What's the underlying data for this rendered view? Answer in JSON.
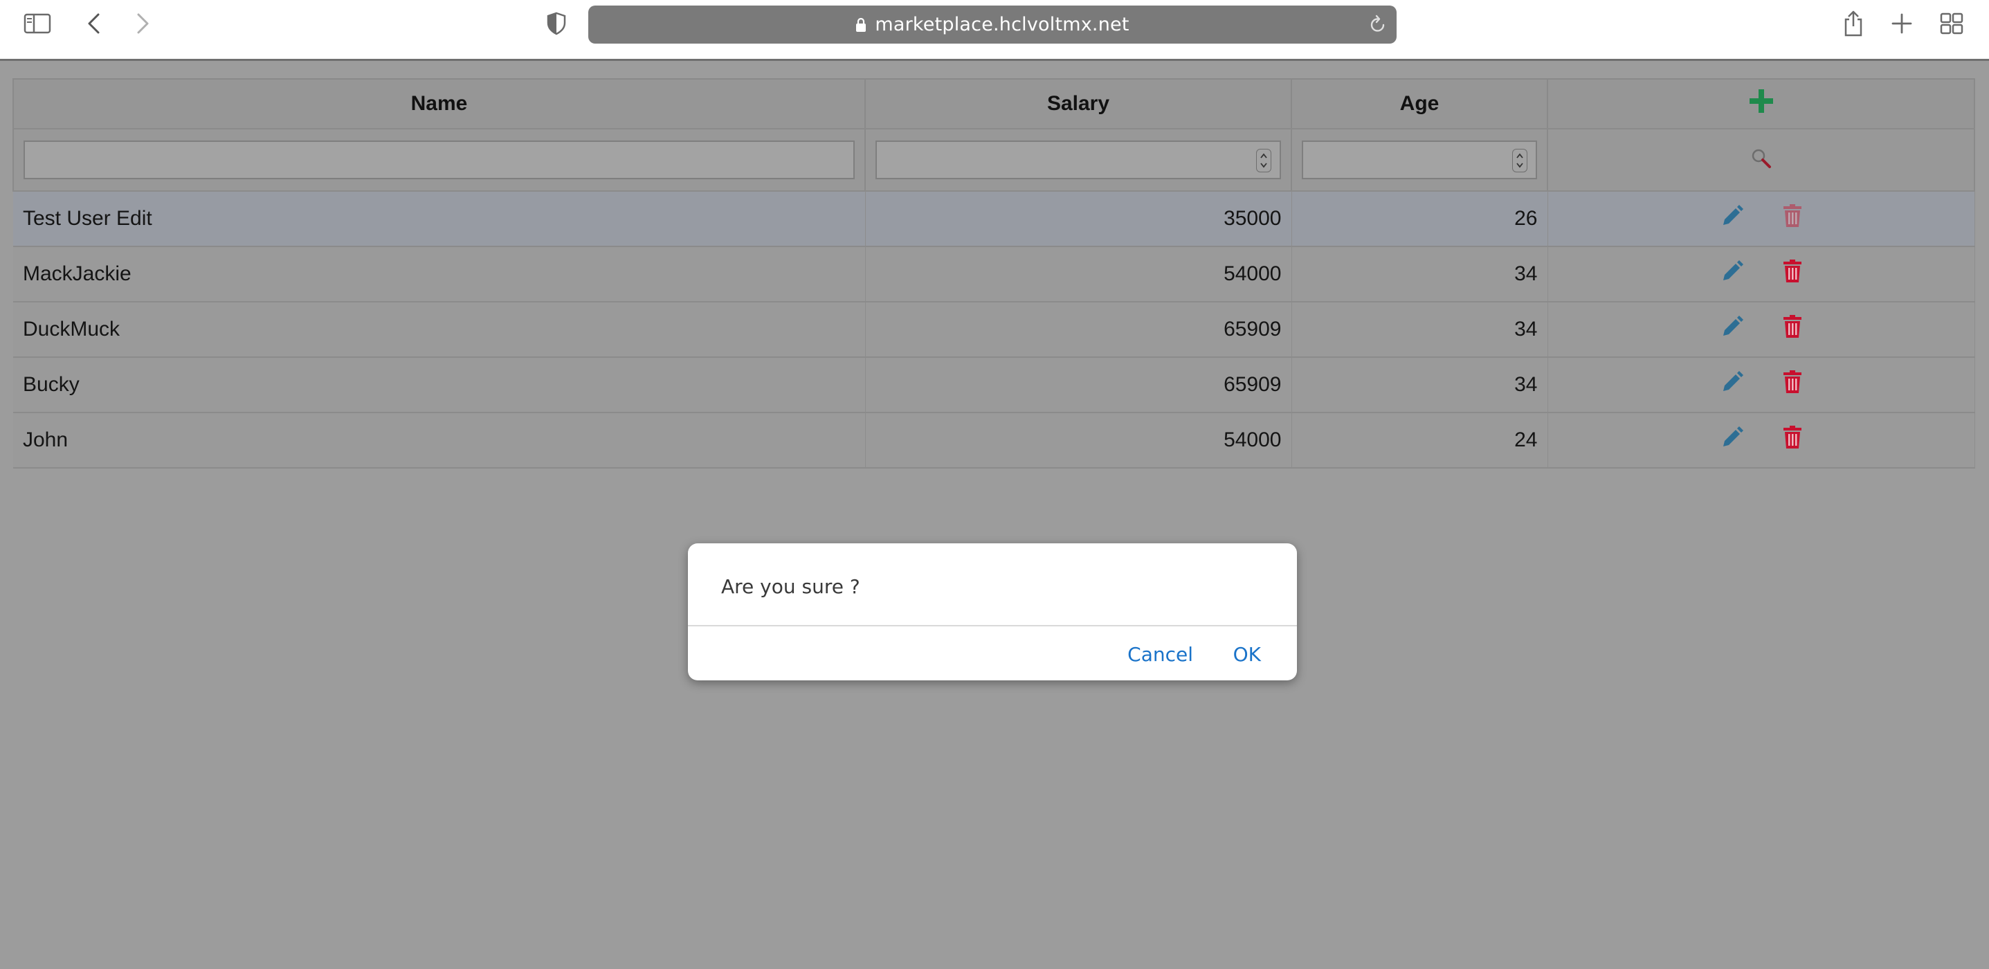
{
  "browser": {
    "url": "marketplace.hclvoltmx.net",
    "icons": [
      "sidebar-icon",
      "back-icon",
      "forward-icon",
      "shield-icon",
      "lock-icon",
      "reload-icon",
      "share-icon",
      "new-tab-icon",
      "tab-overview-icon"
    ]
  },
  "table": {
    "headers": {
      "name": "Name",
      "salary": "Salary",
      "age": "Age"
    },
    "rows": [
      {
        "name": "Test User Edit",
        "salary": "35000",
        "age": "26"
      },
      {
        "name": "MackJackie",
        "salary": "54000",
        "age": "34"
      },
      {
        "name": "DuckMuck",
        "salary": "65909",
        "age": "34"
      },
      {
        "name": "Bucky",
        "salary": "65909",
        "age": "34"
      },
      {
        "name": "John",
        "salary": "54000",
        "age": "24"
      }
    ],
    "filters": {
      "name": "",
      "salary": "",
      "age": ""
    }
  },
  "dialog": {
    "message": "Are you sure ?",
    "cancel_label": "Cancel",
    "ok_label": "OK"
  },
  "colors": {
    "add": "#1f8a4c",
    "edit": "#2d6e94",
    "delete": "#c8102e",
    "link": "#1a73c9"
  }
}
